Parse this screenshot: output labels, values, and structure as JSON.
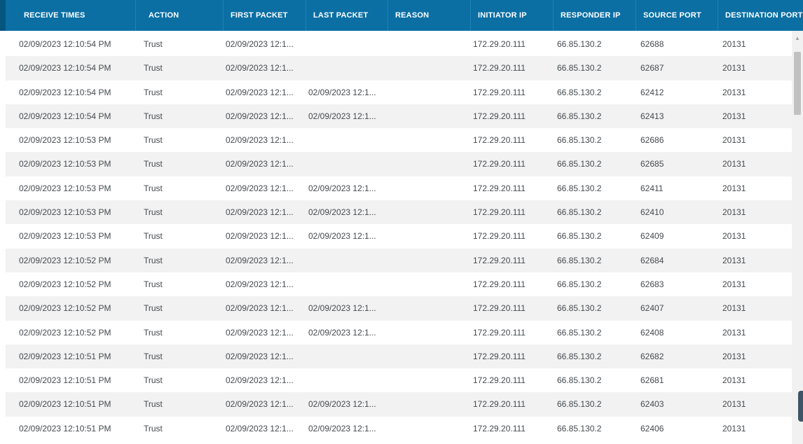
{
  "columns": [
    {
      "label": "RECEIVE TIMES"
    },
    {
      "label": "ACTION"
    },
    {
      "label": "FIRST PACKET"
    },
    {
      "label": "LAST PACKET"
    },
    {
      "label": "REASON"
    },
    {
      "label": "INITIATOR IP"
    },
    {
      "label": "RESPONDER IP"
    },
    {
      "label": "SOURCE PORT"
    },
    {
      "label": "DESTINATION PORT"
    }
  ],
  "rows": [
    [
      "02/09/2023 12:10:54 PM",
      "Trust",
      "02/09/2023 12:1...",
      "",
      "",
      "172.29.20.111",
      "66.85.130.2",
      "62688",
      "20131"
    ],
    [
      "02/09/2023 12:10:54 PM",
      "Trust",
      "02/09/2023 12:1...",
      "",
      "",
      "172.29.20.111",
      "66.85.130.2",
      "62687",
      "20131"
    ],
    [
      "02/09/2023 12:10:54 PM",
      "Trust",
      "02/09/2023 12:1...",
      "02/09/2023 12:1...",
      "",
      "172.29.20.111",
      "66.85.130.2",
      "62412",
      "20131"
    ],
    [
      "02/09/2023 12:10:54 PM",
      "Trust",
      "02/09/2023 12:1...",
      "02/09/2023 12:1...",
      "",
      "172.29.20.111",
      "66.85.130.2",
      "62413",
      "20131"
    ],
    [
      "02/09/2023 12:10:53 PM",
      "Trust",
      "02/09/2023 12:1...",
      "",
      "",
      "172.29.20.111",
      "66.85.130.2",
      "62686",
      "20131"
    ],
    [
      "02/09/2023 12:10:53 PM",
      "Trust",
      "02/09/2023 12:1...",
      "",
      "",
      "172.29.20.111",
      "66.85.130.2",
      "62685",
      "20131"
    ],
    [
      "02/09/2023 12:10:53 PM",
      "Trust",
      "02/09/2023 12:1...",
      "02/09/2023 12:1...",
      "",
      "172.29.20.111",
      "66.85.130.2",
      "62411",
      "20131"
    ],
    [
      "02/09/2023 12:10:53 PM",
      "Trust",
      "02/09/2023 12:1...",
      "02/09/2023 12:1...",
      "",
      "172.29.20.111",
      "66.85.130.2",
      "62410",
      "20131"
    ],
    [
      "02/09/2023 12:10:53 PM",
      "Trust",
      "02/09/2023 12:1...",
      "02/09/2023 12:1...",
      "",
      "172.29.20.111",
      "66.85.130.2",
      "62409",
      "20131"
    ],
    [
      "02/09/2023 12:10:52 PM",
      "Trust",
      "02/09/2023 12:1...",
      "",
      "",
      "172.29.20.111",
      "66.85.130.2",
      "62684",
      "20131"
    ],
    [
      "02/09/2023 12:10:52 PM",
      "Trust",
      "02/09/2023 12:1...",
      "",
      "",
      "172.29.20.111",
      "66.85.130.2",
      "62683",
      "20131"
    ],
    [
      "02/09/2023 12:10:52 PM",
      "Trust",
      "02/09/2023 12:1...",
      "02/09/2023 12:1...",
      "",
      "172.29.20.111",
      "66.85.130.2",
      "62407",
      "20131"
    ],
    [
      "02/09/2023 12:10:52 PM",
      "Trust",
      "02/09/2023 12:1...",
      "02/09/2023 12:1...",
      "",
      "172.29.20.111",
      "66.85.130.2",
      "62408",
      "20131"
    ],
    [
      "02/09/2023 12:10:51 PM",
      "Trust",
      "02/09/2023 12:1...",
      "",
      "",
      "172.29.20.111",
      "66.85.130.2",
      "62682",
      "20131"
    ],
    [
      "02/09/2023 12:10:51 PM",
      "Trust",
      "02/09/2023 12:1...",
      "",
      "",
      "172.29.20.111",
      "66.85.130.2",
      "62681",
      "20131"
    ],
    [
      "02/09/2023 12:10:51 PM",
      "Trust",
      "02/09/2023 12:1...",
      "02/09/2023 12:1...",
      "",
      "172.29.20.111",
      "66.85.130.2",
      "62403",
      "20131"
    ],
    [
      "02/09/2023 12:10:51 PM",
      "Trust",
      "02/09/2023 12:1...",
      "02/09/2023 12:1...",
      "",
      "172.29.20.111",
      "66.85.130.2",
      "62406",
      "20131"
    ]
  ],
  "icons": {
    "scroll_up": "chevron-up-icon"
  },
  "colors": {
    "header_bg": "#0b6fa4",
    "row_alt": "#f2f2f2",
    "text": "#444a4f"
  }
}
